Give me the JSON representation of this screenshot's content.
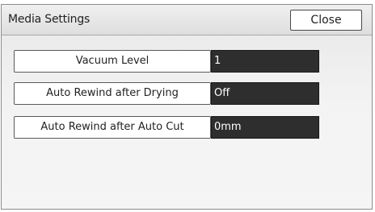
{
  "window": {
    "title": "Media Settings",
    "close_label": "Close"
  },
  "settings": [
    {
      "label": "Vacuum Level",
      "value": "1"
    },
    {
      "label": "Auto Rewind after Drying",
      "value": "Off"
    },
    {
      "label": "Auto Rewind after Auto Cut",
      "value": "0mm"
    }
  ]
}
